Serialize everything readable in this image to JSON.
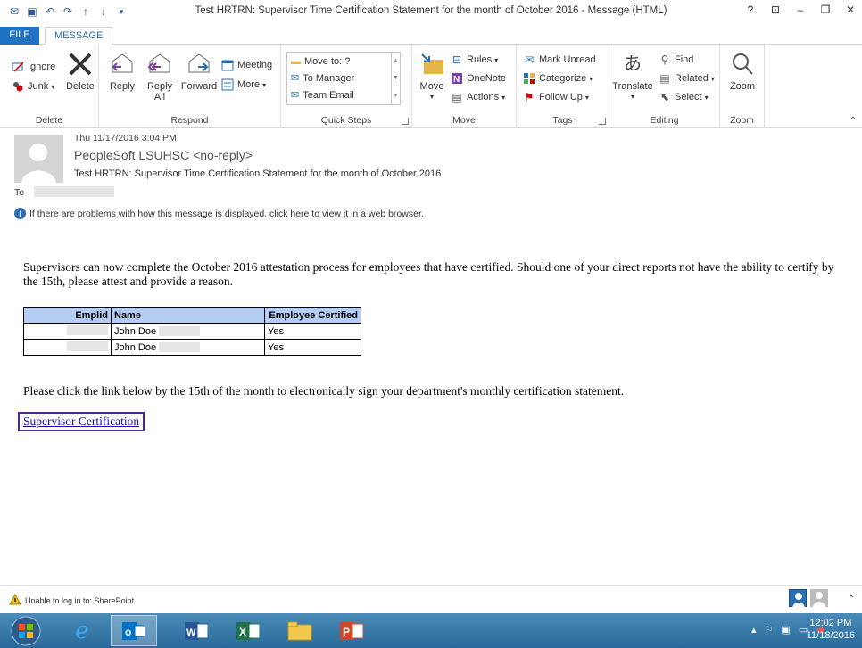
{
  "window": {
    "title": "Test HRTRN: Supervisor Time Certification Statement for the month of October 2016 - Message (HTML)",
    "help": "?"
  },
  "tabs": {
    "file": "FILE",
    "message": "MESSAGE"
  },
  "ribbon": {
    "groups": {
      "delete": "Delete",
      "respond": "Respond",
      "quick_steps": "Quick Steps",
      "move": "Move",
      "tags": "Tags",
      "editing": "Editing",
      "zoom": "Zoom"
    },
    "ignore": "Ignore",
    "junk": "Junk",
    "delete_btn": "Delete",
    "reply": "Reply",
    "reply_all_1": "Reply",
    "reply_all_2": "All",
    "forward": "Forward",
    "meeting": "Meeting",
    "more": "More",
    "quick_steps": [
      "Move to: ?",
      "To Manager",
      "Team Email"
    ],
    "move_btn": "Move",
    "rules": "Rules",
    "onenote": "OneNote",
    "actions": "Actions",
    "mark_unread": "Mark Unread",
    "categorize": "Categorize",
    "follow_up": "Follow Up",
    "translate": "Translate",
    "find": "Find",
    "related": "Related",
    "select": "Select",
    "zoom_btn": "Zoom"
  },
  "message": {
    "date": "Thu 11/17/2016 3:04 PM",
    "from": "PeopleSoft LSUHSC <no-reply>",
    "subject": "Test HRTRN: Supervisor Time Certification Statement for the month of October 2016",
    "to_label": "To",
    "info": "If there are problems with how this message is displayed, click here to view it in a web browser."
  },
  "body": {
    "para1": "Supervisors can now complete the October 2016 attestation process for employees that have certified. Should one of your direct reports not have the ability to certify by the 15th, please attest and provide a reason.",
    "table": {
      "headers": [
        "Emplid",
        "Name",
        "Employee Certified"
      ],
      "rows": [
        {
          "name": "John Doe",
          "certified": "Yes"
        },
        {
          "name": "John Doe",
          "certified": "Yes"
        }
      ]
    },
    "para2": "Please click the link below by the 15th of the month to electronically sign your department's monthly certification statement.",
    "link": "Supervisor Certification"
  },
  "status": {
    "text": "Unable to log in to: SharePoint."
  },
  "taskbar": {
    "time": "12:02 PM",
    "date": "11/18/2016"
  },
  "colors": {
    "accent": "#1e73c4",
    "table_header": "#b3cdf3",
    "link_border": "#4b2a8e"
  }
}
